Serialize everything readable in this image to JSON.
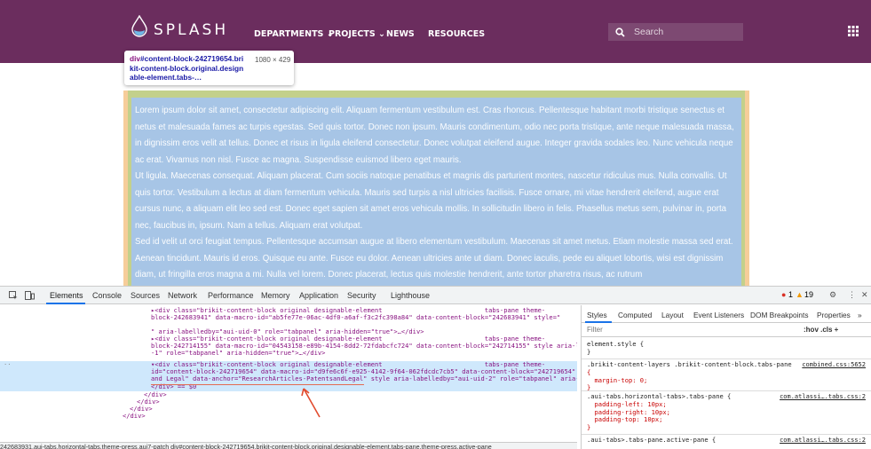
{
  "site": {
    "logo_text": "SPLASH",
    "nav": [
      "DEPARTMENTS ⌄",
      "PROJECTS ⌄",
      "NEWS",
      "RESOURCES"
    ],
    "search_placeholder": "Search"
  },
  "tooltip": {
    "selector_tag": "div",
    "selector_rest": "#content-block-242719654.brikit-content-block.original.designable-element.tabs-…",
    "size": "1080 × 429"
  },
  "content": {
    "p1": "Lorem ipsum dolor sit amet, consectetur adipiscing elit. Aliquam fermentum vestibulum est. Cras rhoncus. Pellentesque habitant morbi tristique senectus et netus et malesuada fames ac turpis egestas. Sed quis tortor. Donec non ipsum. Mauris condimentum, odio nec porta tristique, ante neque malesuada massa, in dignissim eros velit at tellus. Donec et risus in ligula eleifend consectetur. Donec volutpat eleifend augue. Integer gravida sodales leo. Nunc vehicula neque ac erat. Vivamus non nisl. Fusce ac magna. Suspendisse euismod libero eget mauris.",
    "p2": "Ut ligula. Maecenas consequat. Aliquam placerat. Cum sociis natoque penatibus et magnis dis parturient montes, nascetur ridiculus mus. Nulla convallis. Ut quis tortor. Vestibulum a lectus at diam fermentum vehicula. Mauris sed turpis a nisl ultricies facilisis. Fusce ornare, mi vitae hendrerit eleifend, augue erat cursus nunc, a aliquam elit leo sed est. Donec eget sapien sit amet eros vehicula mollis. In sollicitudin libero in felis. Phasellus metus sem, pulvinar in, porta nec, faucibus in, ipsum. Nam a tellus. Aliquam erat volutpat.",
    "p3": "Sed id velit ut orci feugiat tempus. Pellentesque accumsan augue at libero elementum vestibulum. Maecenas sit amet metus. Etiam molestie massa sed erat. Aenean tincidunt. Mauris id eros. Quisque eu ante. Fusce eu dolor. Aenean ultricies ante ut diam. Donec iaculis, pede eu aliquet lobortis, wisi est dignissim diam, ut fringilla eros magna a mi. Nulla vel lorem. Donec placerat, lectus quis molestie hendrerit, ante tortor pharetra risus, ac rutrum"
  },
  "devtools": {
    "tabs": [
      "Elements",
      "Console",
      "Sources",
      "Network",
      "Performance",
      "Memory",
      "Application",
      "Security",
      "Lighthouse"
    ],
    "errors": "1",
    "warnings": "19",
    "code_lines": [
      "<div class=\"brikit-content-block original designable-element                           tabs-pane theme-",
      "block-242683941\" data-macro-id=\"ab5fe77e-06ac-4df0-a6af-f3c2fc398a84\" data-content-block=\"242683941\" style=\"",
      "\" aria-labelledby=\"aui-uid-0\" role=\"tabpanel\" aria-hidden=\"true\">…</div>",
      "<div class=\"brikit-content-block original designable-element                           tabs-pane theme-",
      "block-242714155\" data-macro-id=\"04543158-e89b-4154-8dd2-72fdabcfc724\" data-content-block=\"242714155\" style aria-l",
      "-1\" role=\"tabpanel\" aria-hidden=\"true\">…</div>",
      "<div class=\"brikit-content-block original designable-element                           tabs-pane theme-",
      "id=\"content-block-242719654\" data-macro-id=\"d9fe6c6f-e925-4142-9f64-062fdcdc7cb5\" data-content-block=\"242719654\"",
      "and Legal\" data-anchor=\"ResearchArticles-PatentsandLegal\" style aria-labelledby=\"aui-uid-2\" role=\"tabpanel\" aria-",
      "</div> == $0",
      "</div>",
      "</div>",
      "</div>",
      "</div>"
    ],
    "breadcrumb": "242683931.aui-tabs.horizontal-tabs.theme-press.aui7-patch   div#content-block-242719654.brikit-content-block.original.designable-element.tabs-pane.theme-press.active-pane",
    "styles_tabs": [
      "Styles",
      "Computed",
      "Layout",
      "Event Listeners",
      "DOM Breakpoints",
      "Properties",
      "»"
    ],
    "filter_label": "Filter",
    "filter_right": ":hov  .cls  +",
    "rules": [
      {
        "selector": "element.style {",
        "body": "}",
        "src": ""
      },
      {
        "selector": ".brikit-content-layers .brikit-content-block.tabs-pane",
        "body": "{\n  margin-top: 0;\n}",
        "src": "combined.css:5652"
      },
      {
        "selector": ".aui-tabs.horizontal-tabs>.tabs-pane {",
        "body": "  padding-left: 10px;\n  padding-right: 10px;\n  padding-top: 10px;\n}",
        "src": "com.atlassi….tabs.css:2"
      },
      {
        "selector": ".aui-tabs>.tabs-pane.active-pane {",
        "body": "",
        "src": "com.atlassi….tabs.css:2"
      }
    ]
  },
  "colors": {
    "header": "#6b2d5e",
    "content_highlight": "#a7c5e6",
    "padding_highlight": "#c3d08b",
    "margin_highlight": "#f6cd9a",
    "devtools_accent": "#1a73e8"
  }
}
